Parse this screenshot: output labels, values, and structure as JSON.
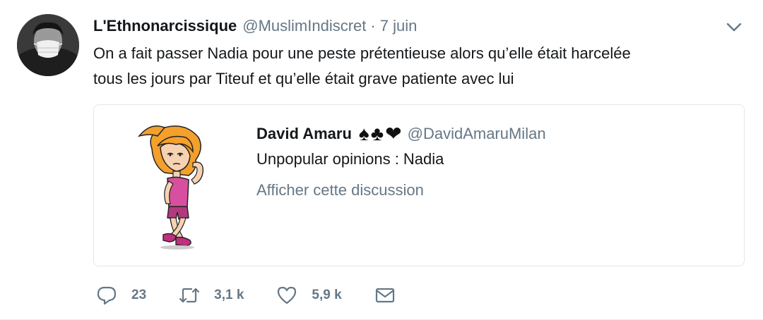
{
  "tweet": {
    "author_name": "L'Ethnonarcissique",
    "author_handle": "@MuslimIndiscret",
    "separator": "·",
    "timestamp": "7 juin",
    "text": "On a fait passer Nadia pour une peste prétentieuse alors qu’elle était harcelée\ntous les jours par Titeuf et qu’elle était grave patiente avec lui",
    "avatar_icon": "avatar-masked-person",
    "menu_icon": "chevron-down-icon"
  },
  "quote": {
    "author_name": "David Amaru",
    "name_emoji": [
      "♠",
      "♣",
      "❤"
    ],
    "author_handle": "@DavidAmaruMilan",
    "text": "Unpopular opinions : Nadia",
    "show_thread_label": "Afficher cette discussion",
    "media_icon": "cartoon-girl-nadia"
  },
  "actions": {
    "reply_count": "23",
    "retweet_count": "3,1 k",
    "like_count": "5,9 k",
    "icons": [
      "reply-icon",
      "retweet-icon",
      "like-icon",
      "message-icon"
    ]
  },
  "colors": {
    "text_primary": "#14171a",
    "text_secondary": "#657786",
    "border": "#e1e8ed",
    "background": "#ffffff"
  }
}
